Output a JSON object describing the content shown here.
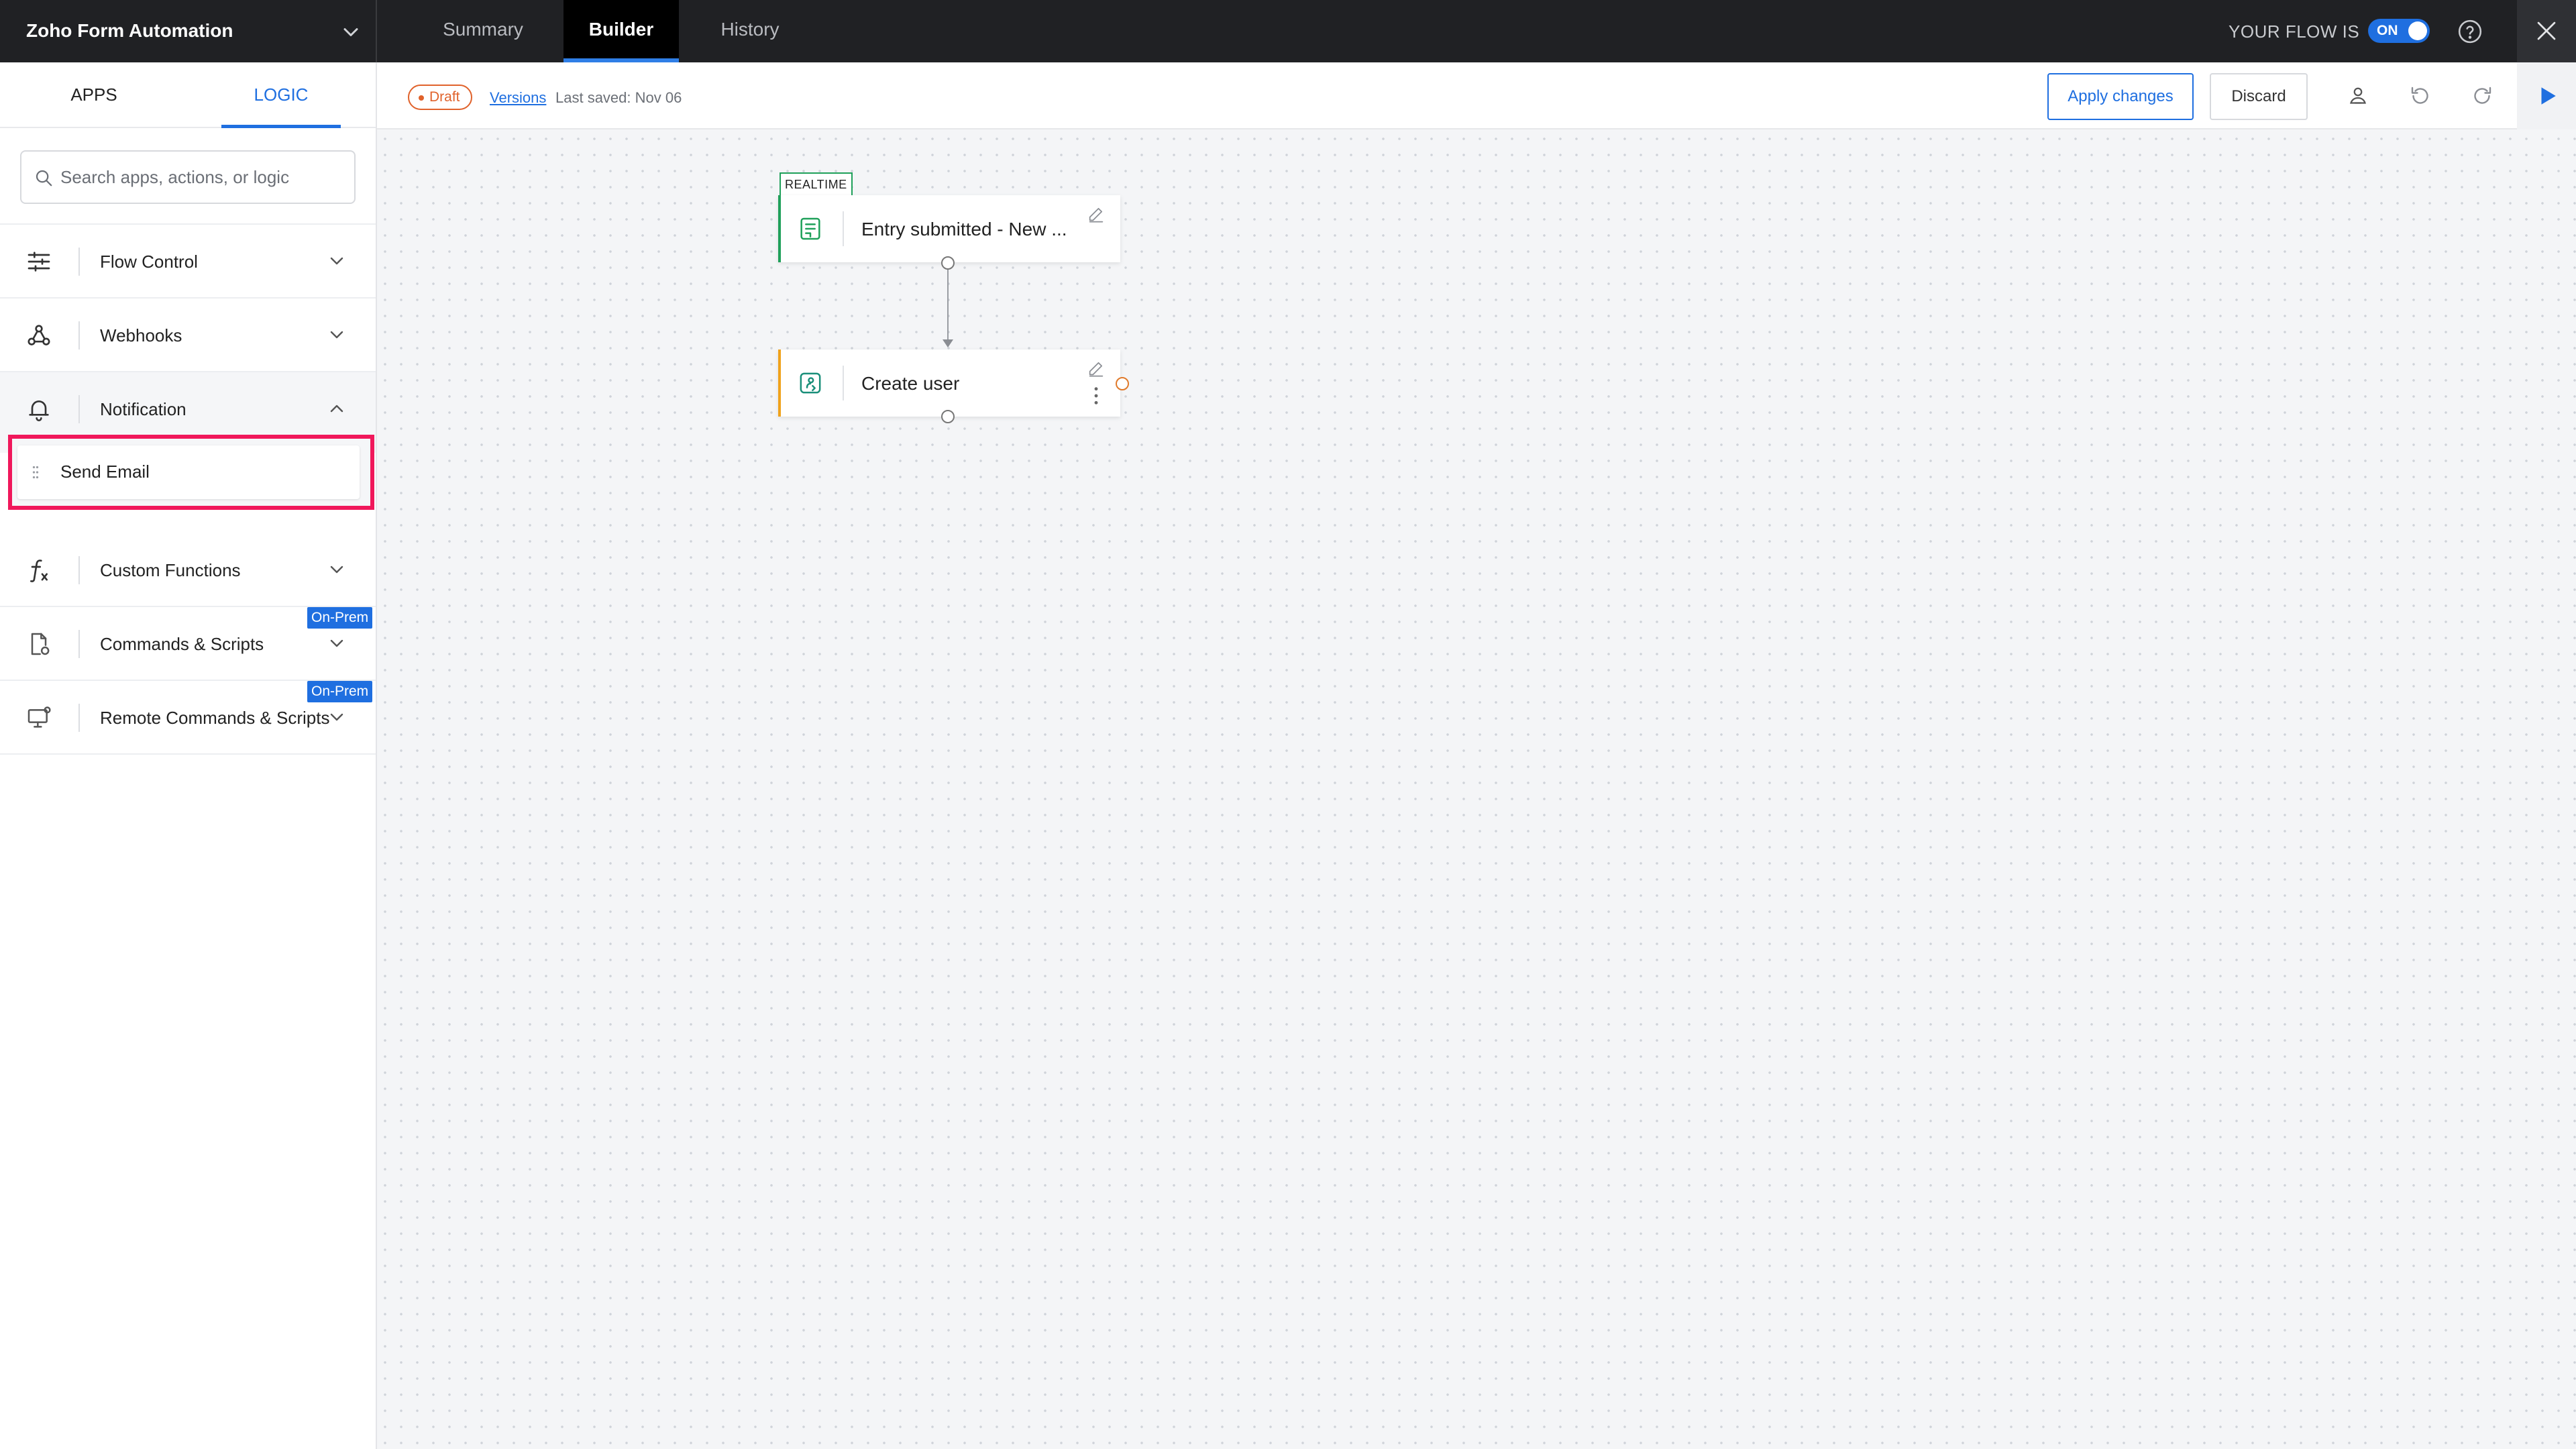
{
  "app": {
    "flow_name": "Zoho Form Automation"
  },
  "header": {
    "tabs": [
      {
        "label": "Summary",
        "active": false
      },
      {
        "label": "Builder",
        "active": true
      },
      {
        "label": "History",
        "active": false
      }
    ],
    "flow_status_label": "YOUR FLOW IS",
    "toggle_label": "ON",
    "toggle_on": true,
    "accent_color": "#1f6fe0"
  },
  "sidebar": {
    "tabs": [
      {
        "label": "APPS",
        "active": false
      },
      {
        "label": "LOGIC",
        "active": true
      }
    ],
    "search": {
      "placeholder": "Search apps, actions, or logic",
      "value": ""
    },
    "categories": [
      {
        "label": "Flow Control",
        "icon": "sliders-icon",
        "expanded": false
      },
      {
        "label": "Webhooks",
        "icon": "webhook-icon",
        "expanded": false
      },
      {
        "label": "Notification",
        "icon": "bell-icon",
        "expanded": true,
        "items": [
          {
            "label": "Send Email"
          }
        ]
      },
      {
        "label": "Custom Functions",
        "icon": "function-icon",
        "expanded": false
      },
      {
        "label": "Commands & Scripts",
        "icon": "script-file-icon",
        "expanded": false,
        "badge": "On-Prem"
      },
      {
        "label": "Remote Commands & Scripts",
        "icon": "remote-monitor-icon",
        "expanded": false,
        "badge": "On-Prem"
      }
    ],
    "highlight_color": "#f0185b"
  },
  "actionbar": {
    "status_badge": "Draft",
    "versions_link": "Versions",
    "last_saved": "Last saved: Nov 06",
    "apply_label": "Apply changes",
    "discard_label": "Discard"
  },
  "canvas": {
    "trigger": {
      "tag": "REALTIME",
      "title": "Entry submitted - New ...",
      "accent": "#1fa05a"
    },
    "action": {
      "title": "Create user",
      "accent": "#f0a21b"
    }
  }
}
